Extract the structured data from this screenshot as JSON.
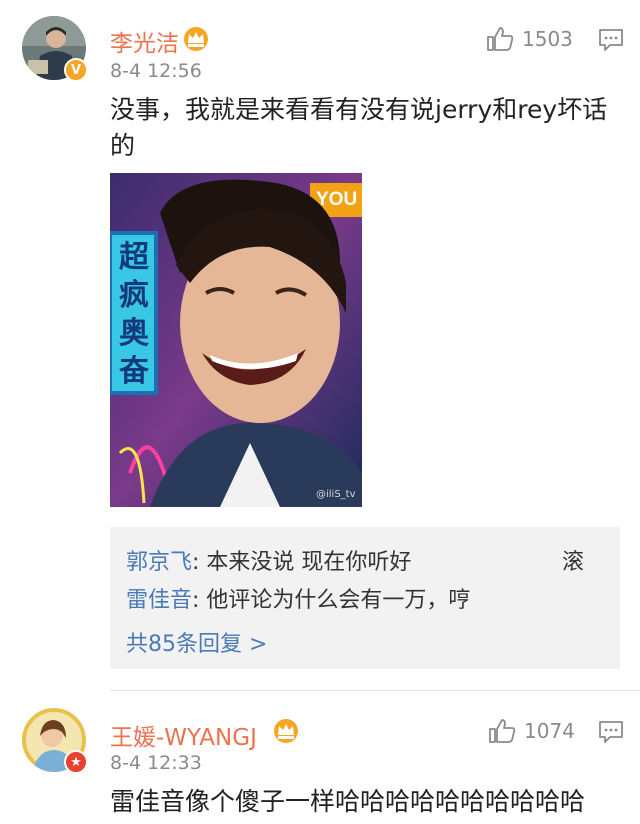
{
  "comments": [
    {
      "username": "李光洁",
      "timestamp": "8-4 12:56",
      "like_count": "1503",
      "text_line1": "没事，我就是来看看有没有说jerry和rey坏话",
      "text_line2": "的",
      "verified_badge": "V",
      "photo": {
        "corner_label": "YOU",
        "side_label": "超\n疯\n奥\n奋",
        "watermark": "@iliS_tv"
      },
      "replies": [
        {
          "name": "郭京飞",
          "text": "本来没说 现在你听好",
          "trail": "滚"
        },
        {
          "name": "雷佳音",
          "text": "他评论为什么会有一万，哼",
          "trail": ""
        }
      ],
      "more_replies": "共85条回复 >"
    },
    {
      "username": "王媛-WYANGJ",
      "timestamp": "8-4 12:33",
      "like_count": "1074",
      "text_line1": "雷佳音像个傻子一样哈哈哈哈哈哈哈哈哈哈",
      "verified_badge": "★"
    }
  ],
  "colors": {
    "username": "#eb7350",
    "reply_name": "#4a7ab8",
    "muted": "#8a8a8a",
    "reply_bg": "#f2f2f2"
  },
  "icons": [
    "thumbs-up-icon",
    "comment-reply-icon",
    "crown-vip-icon",
    "verified-badge-icon"
  ]
}
